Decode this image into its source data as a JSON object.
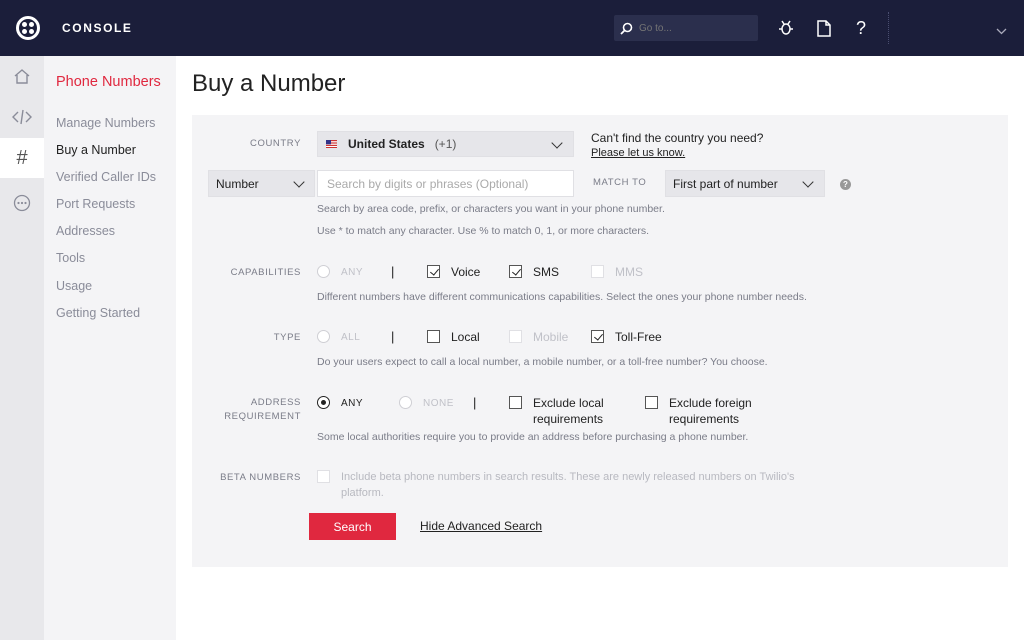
{
  "topbar": {
    "app_title": "CONSOLE",
    "search_placeholder": "Go to..."
  },
  "sidebar": {
    "title": "Phone Numbers",
    "items": [
      {
        "label": "Manage Numbers"
      },
      {
        "label": "Buy a Number"
      },
      {
        "label": "Verified Caller IDs"
      },
      {
        "label": "Port Requests"
      },
      {
        "label": "Addresses"
      },
      {
        "label": "Tools"
      },
      {
        "label": "Usage"
      },
      {
        "label": "Getting Started"
      }
    ]
  },
  "page": {
    "title": "Buy a Number"
  },
  "form": {
    "country": {
      "label": "COUNTRY",
      "value": "United States",
      "code": "(+1)",
      "help_text": "Can't find the country you need?",
      "help_link": "Please let us know."
    },
    "search": {
      "type_value": "Number",
      "placeholder": "Search by digits or phrases (Optional)",
      "match_to_label": "MATCH TO",
      "match_to_value": "First part of number",
      "help_icon": "?",
      "hint1": "Search by area code, prefix, or characters you want in your phone number.",
      "hint2": "Use * to match any character. Use % to match 0, 1, or more characters."
    },
    "capabilities": {
      "label": "CAPABILITIES",
      "any": "ANY",
      "voice": "Voice",
      "sms": "SMS",
      "mms": "MMS",
      "help": "Different numbers have different communications capabilities. Select the ones your phone number needs."
    },
    "type": {
      "label": "TYPE",
      "all": "ALL",
      "local": "Local",
      "mobile": "Mobile",
      "tollfree": "Toll-Free",
      "help": "Do your users expect to call a local number, a mobile number, or a toll-free number? You choose."
    },
    "address": {
      "label1": "ADDRESS",
      "label2": "REQUIREMENT",
      "any": "ANY",
      "none": "NONE",
      "exclude_local_1": "Exclude local",
      "exclude_local_2": "requirements",
      "exclude_foreign_1": "Exclude foreign",
      "exclude_foreign_2": "requirements",
      "help": "Some local authorities require you to provide an address before purchasing a phone number."
    },
    "beta": {
      "label": "BETA NUMBERS",
      "text1": "Include beta phone numbers in search results. These are newly released numbers on Twilio's",
      "text2": "platform."
    },
    "separator": "|",
    "search_button": "Search",
    "hide_advanced": "Hide Advanced Search"
  },
  "colors": {
    "topbar": "#1b1e3a",
    "accent": "#e0283f"
  }
}
